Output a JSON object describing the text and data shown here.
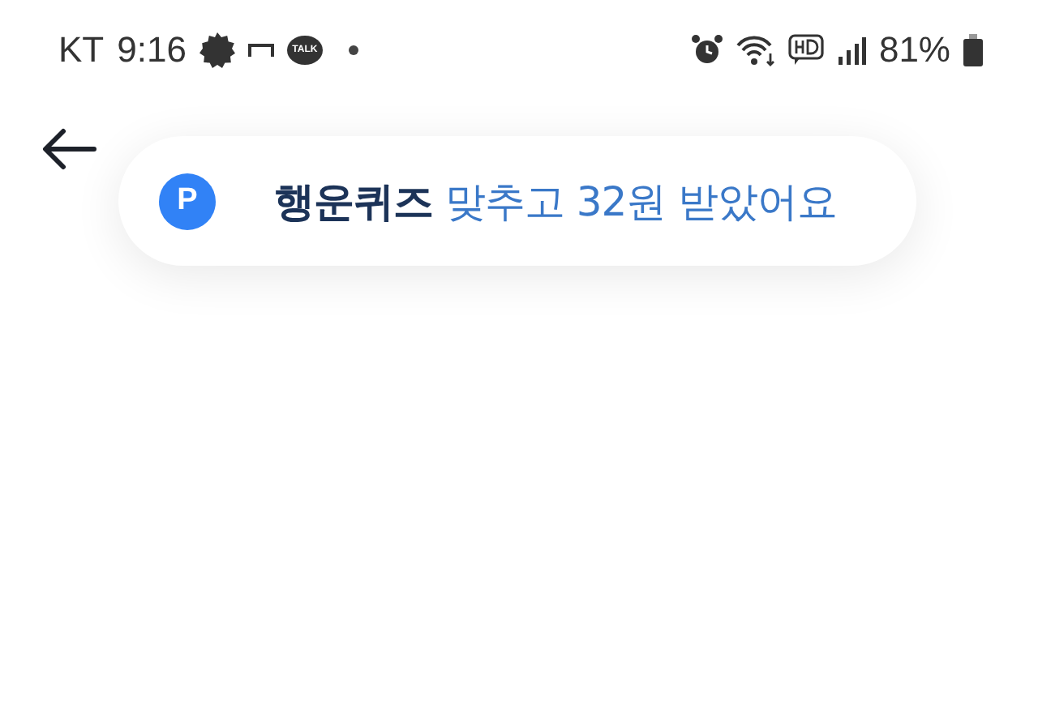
{
  "status_bar": {
    "carrier": "KT",
    "time": "9:16",
    "talk_badge": "TALK",
    "battery": "81%"
  },
  "toast": {
    "badge": "P",
    "lead": "행운퀴즈",
    "message": "맞추고 32원 받았어요"
  }
}
